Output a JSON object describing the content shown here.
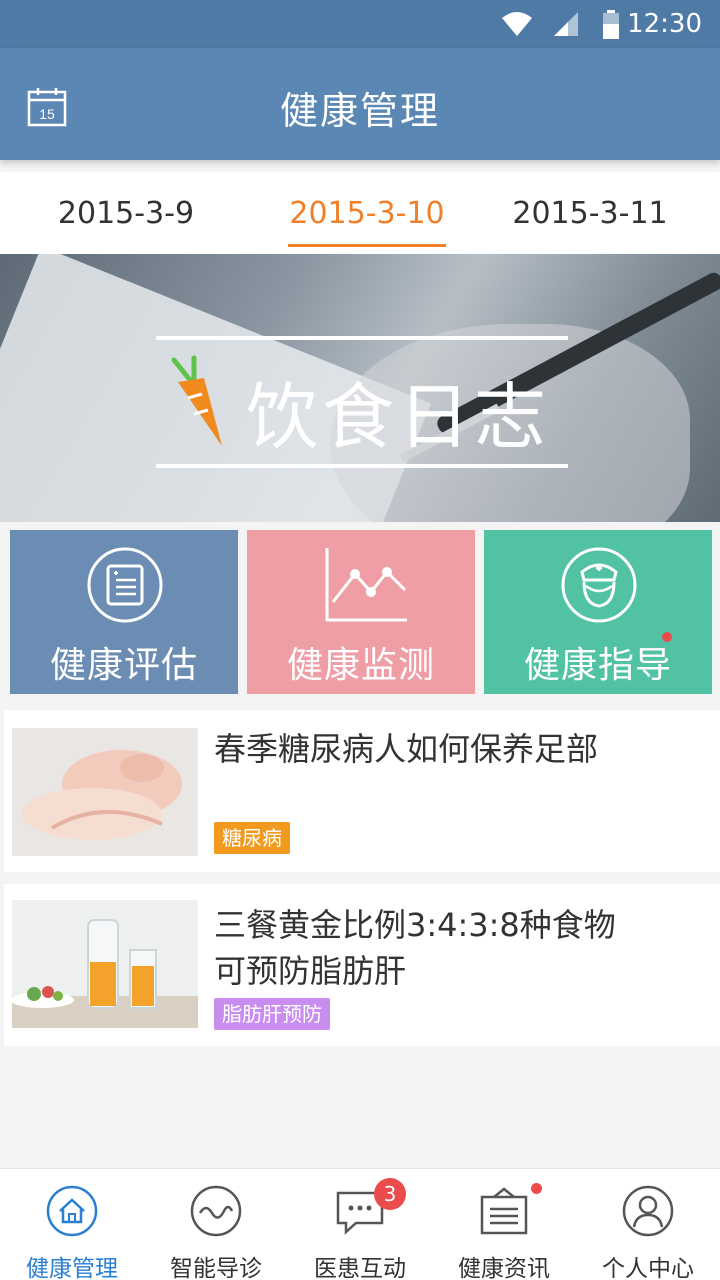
{
  "status_bar": {
    "time": "12:30",
    "icons": [
      "wifi-icon",
      "signal-icon",
      "battery-icon"
    ]
  },
  "app_bar": {
    "title": "健康管理",
    "calendar_day": "15"
  },
  "date_tabs": [
    "2015-3-9",
    "2015-3-10",
    "2015-3-11"
  ],
  "active_date_index": 1,
  "banner": {
    "title": "饮食日志"
  },
  "tiles": [
    {
      "label": "健康评估",
      "icon": "report-icon",
      "color": "#6b8db3"
    },
    {
      "label": "健康监测",
      "icon": "line-chart-icon",
      "color": "#ef9ea6"
    },
    {
      "label": "健康指导",
      "icon": "nurse-icon",
      "color": "#52c2a4",
      "has_dot": true
    }
  ],
  "articles": [
    {
      "headline": "春季糖尿病人如何保养足部",
      "tag": "糖尿病",
      "tag_color": "#f29a1d"
    },
    {
      "headline_line1": "三餐黄金比例3:4:3:8种食物",
      "headline_line2": "可预防脂肪肝",
      "tag": "脂肪肝预防",
      "tag_color": "#c98df0"
    }
  ],
  "bottom_nav": [
    {
      "label": "健康管理",
      "icon": "home-icon",
      "active": true
    },
    {
      "label": "智能导诊",
      "icon": "pulse-icon"
    },
    {
      "label": "医患互动",
      "icon": "chat-icon",
      "badge": "3"
    },
    {
      "label": "健康资讯",
      "icon": "news-icon",
      "has_dot": true
    },
    {
      "label": "个人中心",
      "icon": "user-icon"
    }
  ],
  "colors": {
    "primary": "#5b87b5",
    "accent": "#f0812c",
    "active_nav": "#2a7fd0",
    "badge": "#ec4b4b"
  }
}
